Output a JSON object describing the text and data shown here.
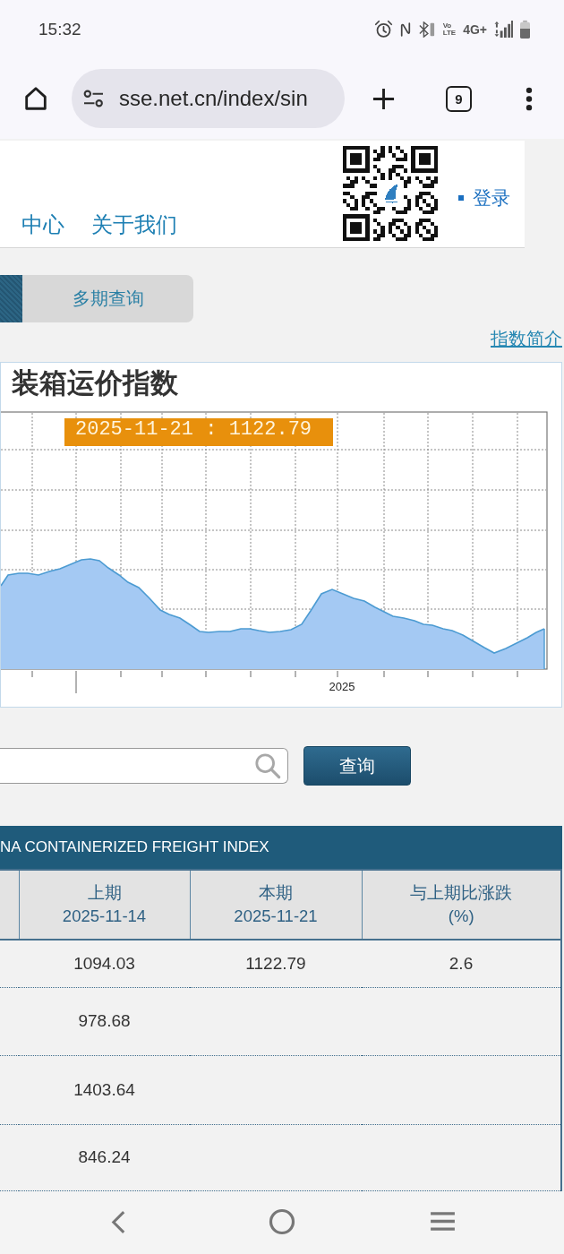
{
  "status_bar": {
    "time": "15:32",
    "volte": [
      "Vo",
      "LTE"
    ],
    "network": "4G+"
  },
  "browser": {
    "url": "sse.net.cn/index/sin",
    "tab_count": "9"
  },
  "header": {
    "nav": [
      "中心",
      "关于我们"
    ],
    "login": "登录"
  },
  "tabs": [
    {
      "selected": true
    },
    {
      "label": "多期查询",
      "selected": false
    }
  ],
  "intro_link": "指数简介",
  "chart": {
    "title": "装箱运价指数",
    "tooltip": "2025-11-21 : 1122.79",
    "x_label": "2025"
  },
  "search": {
    "button": "查询"
  },
  "table": {
    "title": "NA CONTAINERIZED FREIGHT INDEX",
    "columns": [
      {
        "lines": [
          "上期",
          "2025-11-14"
        ]
      },
      {
        "lines": [
          "本期",
          "2025-11-21"
        ]
      },
      {
        "lines": [
          "与上期比涨跌",
          "(%)"
        ]
      }
    ],
    "rows": [
      {
        "cells": [
          "1094.03",
          "1122.79",
          "2.6"
        ]
      },
      {
        "cells": [
          "978.68"
        ]
      },
      {
        "cells": [
          "1403.64"
        ]
      },
      {
        "cells": [
          "846.24"
        ]
      }
    ]
  }
}
